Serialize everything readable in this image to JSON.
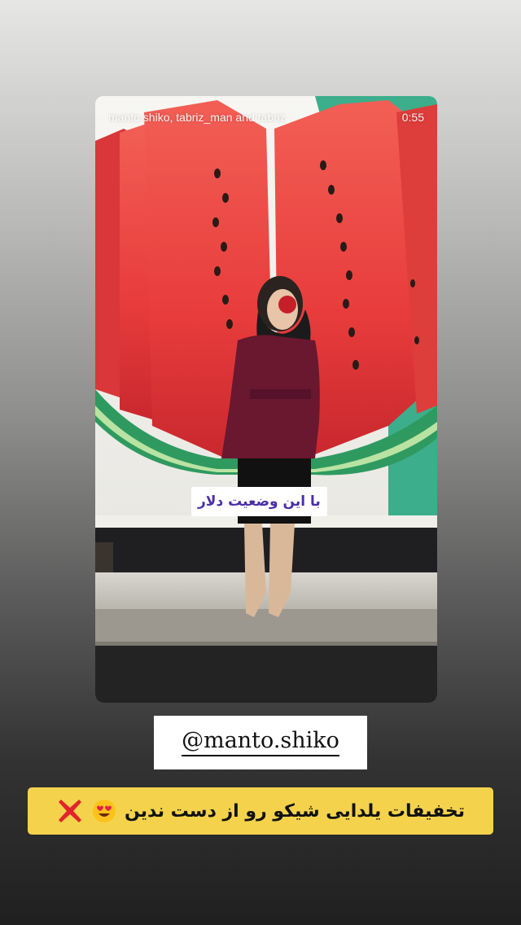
{
  "story": {
    "users": "manto.shiko, tabriz_man and tabriz",
    "timestamp": "0:55",
    "video_caption": "با این وضعیت دلار"
  },
  "mention": {
    "handle": "@manto.shiko"
  },
  "promo": {
    "text": "تخفیفات یلدایی شیکو رو از دست ندین",
    "heart_eyes_icon": "smiling-face-heart-eyes-icon",
    "cross_icon": "cross-mark-icon"
  },
  "colors": {
    "caption_text": "#4a2fa8",
    "promo_background": "#f4d24b",
    "watermelon_flesh": "#e83c3c",
    "watermelon_rind": "#2f9a60"
  }
}
